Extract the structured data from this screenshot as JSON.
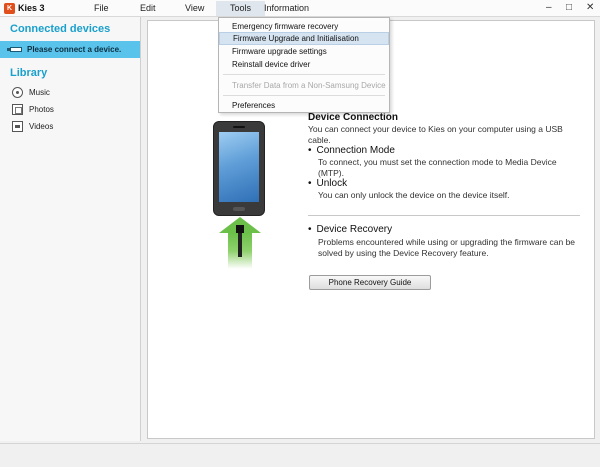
{
  "app": {
    "title": "Kies 3",
    "logo_text": "K"
  },
  "menubar": {
    "file": "File",
    "edit": "Edit",
    "view": "View",
    "tools": "Tools",
    "information": "Information"
  },
  "window_controls": {
    "minimize": "–",
    "maximize": "□",
    "close": "✕"
  },
  "sidebar": {
    "connected_heading": "Connected devices",
    "connect_prompt": "Please connect a device.",
    "library_heading": "Library",
    "items": [
      {
        "label": "Music",
        "icon": "music-icon"
      },
      {
        "label": "Photos",
        "icon": "photos-icon"
      },
      {
        "label": "Videos",
        "icon": "videos-icon"
      }
    ]
  },
  "tools_menu": {
    "items": [
      {
        "label": "Emergency firmware recovery",
        "state": "normal"
      },
      {
        "label": "Firmware Upgrade and Initialisation",
        "state": "highlighted"
      },
      {
        "label": "Firmware upgrade settings",
        "state": "normal"
      },
      {
        "label": "Reinstall device driver",
        "state": "normal"
      },
      {
        "label": "Transfer Data from a Non-Samsung Device",
        "state": "disabled"
      },
      {
        "label": "Preferences",
        "state": "normal"
      }
    ]
  },
  "main": {
    "connection_title": "Device Connection",
    "connection_text": "You can connect your device to Kies on your computer using a USB cable.",
    "mode_heading": "Connection Mode",
    "mode_text": "To connect, you must set the connection mode to Media Device (MTP).",
    "unlock_heading": "Unlock",
    "unlock_text": "You can only unlock the device on the device itself.",
    "recovery_heading": "Device Recovery",
    "recovery_text": "Problems encountered while using or upgrading the firmware can be solved by using the Device Recovery feature.",
    "guide_button": "Phone Recovery Guide"
  },
  "colors": {
    "accent": "#1aa0cc",
    "selection": "#59c3ec",
    "arrow_green": "#6cc04a",
    "menu_highlight": "#d6e4f2"
  }
}
